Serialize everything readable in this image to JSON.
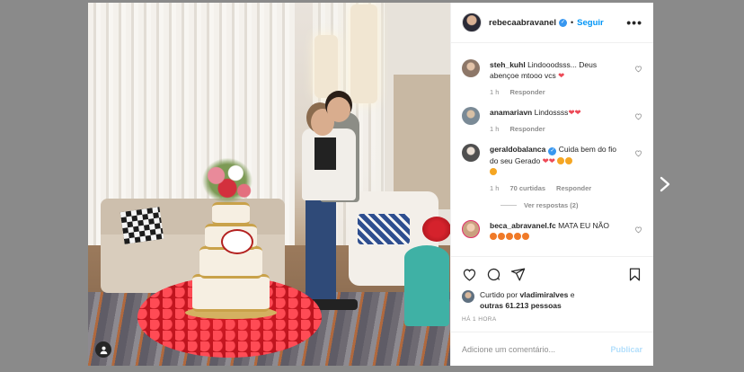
{
  "post": {
    "username": "rebecaabravanel",
    "follow_label": "Seguir",
    "more_label": "•••",
    "verified": true
  },
  "comments": [
    {
      "username": "steh_kuhl",
      "text": "Lindooodsss... Deus abençoe mtooo vcs",
      "emoji": "❤",
      "time": "1 h",
      "reply_label": "Responder",
      "avatar_color": "#8d7768"
    },
    {
      "username": "anamariavn",
      "text": "Lindossss",
      "emoji": "❤❤",
      "time": "1 h",
      "reply_label": "Responder",
      "avatar_color": "#7a8a96"
    },
    {
      "username": "geraldobalanca",
      "verified": true,
      "text": "Cuida bem do fio do seu Gerado",
      "emoji": "❤❤",
      "time": "1 h",
      "likes": "70 curtidas",
      "reply_label": "Responder",
      "view_replies": "Ver respostas (2)",
      "avatar_color": "#5b5b5b"
    },
    {
      "username": "beca_abravanel.fc",
      "text": "MATA EU NÃO",
      "avatar_color": "#c9a07f"
    }
  ],
  "likes": {
    "prefix": "Curtido por",
    "user": "vladimiralves",
    "and": "e",
    "others": "outras 61.213 pessoas"
  },
  "time_ago": "HÁ 1 HORA",
  "add_comment": {
    "placeholder": "Adicione um comentário...",
    "publish_label": "Publicar"
  },
  "colors": {
    "accent": "#0095f6",
    "heart": "#ed4956",
    "verified": "#3897f0"
  },
  "icons": [
    "user-tag-icon",
    "heart-icon",
    "comment-icon",
    "share-icon",
    "bookmark-icon",
    "chevron-right-icon",
    "more-icon"
  ]
}
